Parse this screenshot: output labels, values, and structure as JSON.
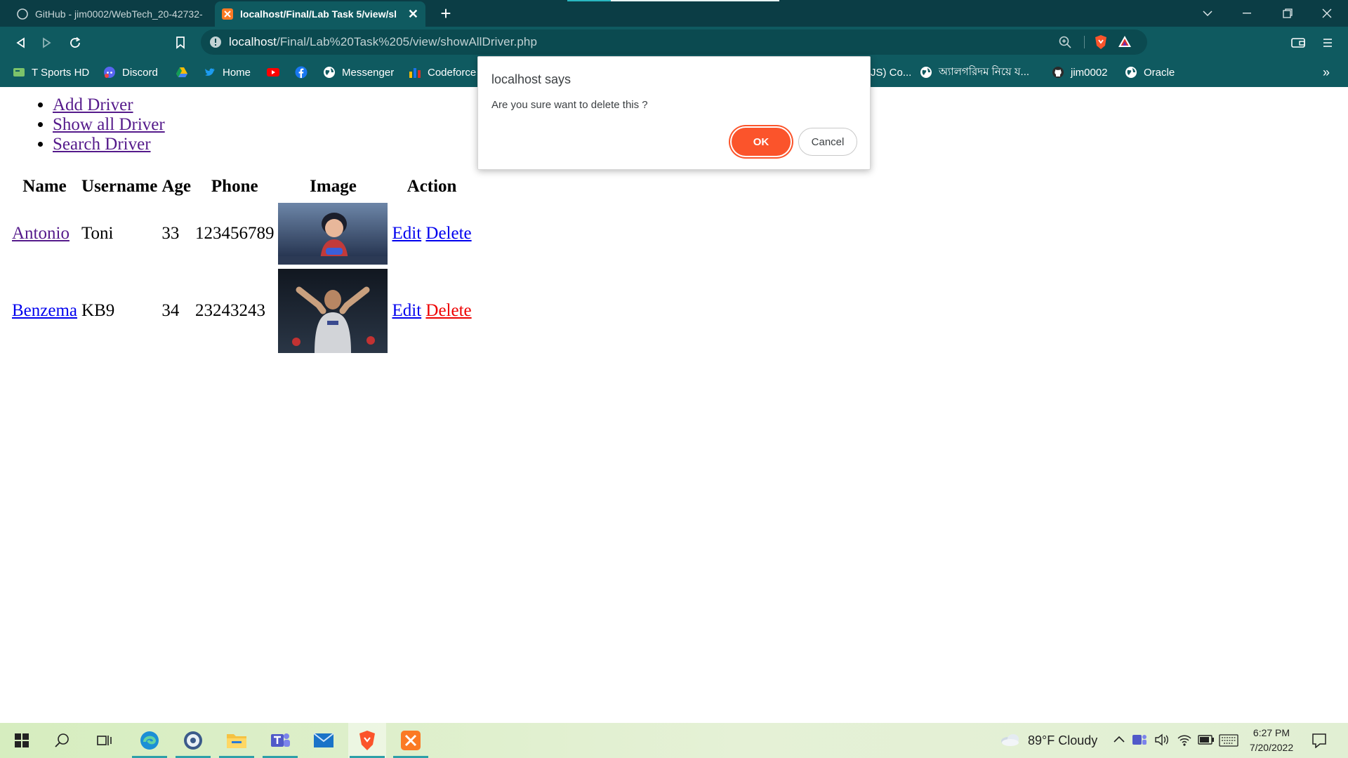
{
  "browser": {
    "tabs": [
      {
        "title": "GitHub - jim0002/WebTech_20-42732-",
        "active": false
      },
      {
        "title": "localhost/Final/Lab Task 5/view/sl",
        "active": true
      }
    ],
    "url": {
      "host": "localhost",
      "path": "/Final/Lab%20Task%205/view/showAllDriver.php"
    },
    "accent": "#fb542b",
    "bookmarks": [
      "T Sports HD",
      "Discord",
      "",
      "Home",
      "",
      "",
      "Messenger",
      "Codeforce",
      "JS) Co...",
      "অ্যালগরিদম নিয়ে য...",
      "jim0002",
      "Oracle"
    ],
    "overflow": "»"
  },
  "page": {
    "nav": [
      "Add Driver",
      "Show all Driver",
      "Search Driver"
    ],
    "table": {
      "headers": [
        "Name",
        "Username",
        "Age",
        "Phone",
        "Image",
        "Action"
      ],
      "rows": [
        {
          "name": "Antonio",
          "username": "Toni",
          "age": "33",
          "phone": "123456789",
          "edit": "Edit",
          "delete": "Delete"
        },
        {
          "name": "Benzema",
          "username": "KB9",
          "age": "34",
          "phone": "23243243",
          "edit": "Edit",
          "delete": "Delete"
        }
      ]
    }
  },
  "dialog": {
    "title": "localhost says",
    "message": "Are you sure want to delete this ?",
    "ok": "OK",
    "cancel": "Cancel"
  },
  "taskbar": {
    "weather": "89°F  Cloudy",
    "time": "6:27 PM",
    "date": "7/20/2022"
  }
}
